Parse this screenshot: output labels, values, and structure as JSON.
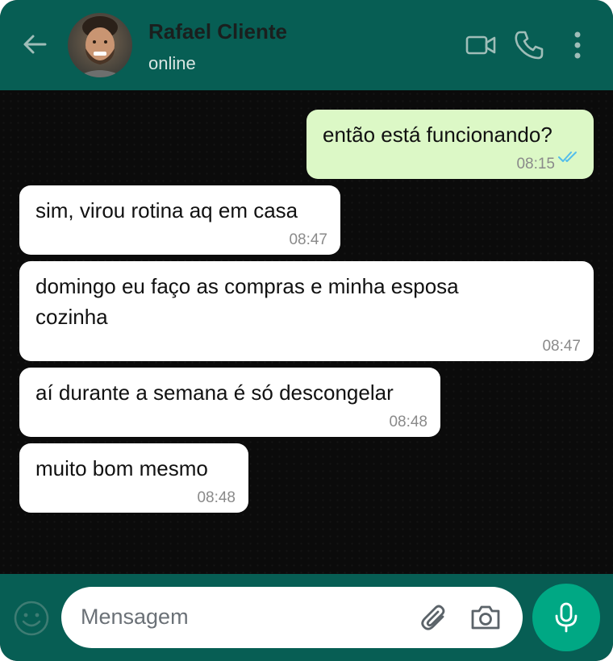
{
  "contact": {
    "name": "Rafael Cliente",
    "status": "online"
  },
  "messages": [
    {
      "direction": "out",
      "text": "então está funcionando?",
      "time": "08:15",
      "read": true
    },
    {
      "direction": "in",
      "text": "sim, virou rotina aq em casa",
      "time": "08:47"
    },
    {
      "direction": "in",
      "text": "domingo eu faço as compras e minha esposa cozinha",
      "time": "08:47"
    },
    {
      "direction": "in",
      "text": "aí durante a semana é só descongelar",
      "time": "08:48"
    },
    {
      "direction": "in",
      "text": "muito bom mesmo",
      "time": "08:48"
    }
  ],
  "composer": {
    "placeholder": "Mensagem"
  },
  "icons": {
    "back": "arrow-left-icon",
    "video": "video-camera-icon",
    "call": "phone-icon",
    "menu": "more-vertical-icon",
    "emoji": "smiley-icon",
    "attach": "paperclip-icon",
    "camera": "camera-icon",
    "mic": "microphone-icon",
    "read": "double-check-icon"
  },
  "colors": {
    "header": "#075e54",
    "outgoing_bubble": "#dcf8c6",
    "incoming_bubble": "#ffffff",
    "accent": "#00a884",
    "read_ticks": "#53bdeb"
  }
}
